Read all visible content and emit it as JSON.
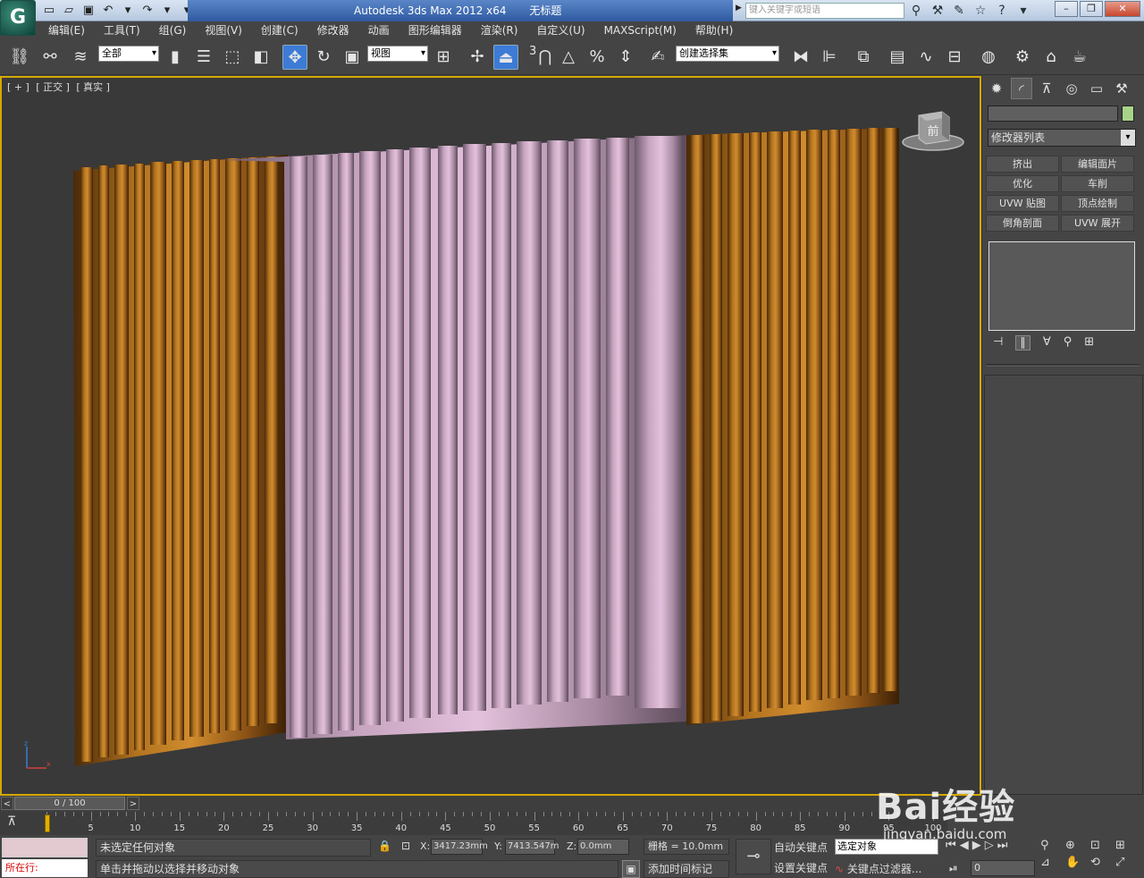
{
  "title": {
    "app_logo": "G",
    "app_name": "Autodesk 3ds Max  2012 x64",
    "document": "无标题",
    "search_placeholder": "键入关键字或短语"
  },
  "menu": [
    "编辑(E)",
    "工具(T)",
    "组(G)",
    "视图(V)",
    "创建(C)",
    "修改器",
    "动画",
    "图形编辑器",
    "渲染(R)",
    "自定义(U)",
    "MAXScript(M)",
    "帮助(H)"
  ],
  "toolbar": {
    "filter_value": "全部",
    "refcoord_value": "视图",
    "selection_set_placeholder": "创建选择集",
    "snap_3_label": "3"
  },
  "viewport": {
    "label_plus": "[ + ]",
    "label_view": "[ 正交 ]",
    "label_shading": "[ 真实 ]",
    "viewcube_face": "前",
    "axis_z": "z",
    "axis_x": "x",
    "curtain_colors": {
      "brown": "#9c5e1c",
      "pink": "#d9b3cf"
    }
  },
  "command_panel": {
    "modifier_list": "修改器列表",
    "object_color": "#a8d48a",
    "modifier_buttons": [
      "挤出",
      "编辑面片",
      "优化",
      "车削",
      "UVW 贴图",
      "顶点绘制",
      "倒角剖面",
      "UVW 展开"
    ]
  },
  "timeline": {
    "frame_display": "0 / 100",
    "ticks": [
      0,
      5,
      10,
      15,
      20,
      25,
      30,
      35,
      40,
      45,
      50,
      55,
      60,
      65,
      70,
      75,
      80,
      85,
      90,
      95,
      100
    ]
  },
  "status": {
    "running": "所在行:",
    "selection_status": "未选定任何对象",
    "prompt": "单击并拖动以选择并移动对象",
    "x_label": "X:",
    "x_value": "3417.23mm",
    "y_label": "Y:",
    "y_value": "7413.547m",
    "z_label": "Z:",
    "z_value": "0.0mm",
    "grid": "栅格 = 10.0mm",
    "add_time_tag": "添加时间标记",
    "auto_key": "自动关键点",
    "set_key": "设置关键点",
    "key_mode": "选定对象",
    "key_filters": "关键点过滤器...",
    "current_frame": "0"
  },
  "watermark": {
    "main": "Bai经验",
    "sub": "jingyan.baidu.com"
  }
}
